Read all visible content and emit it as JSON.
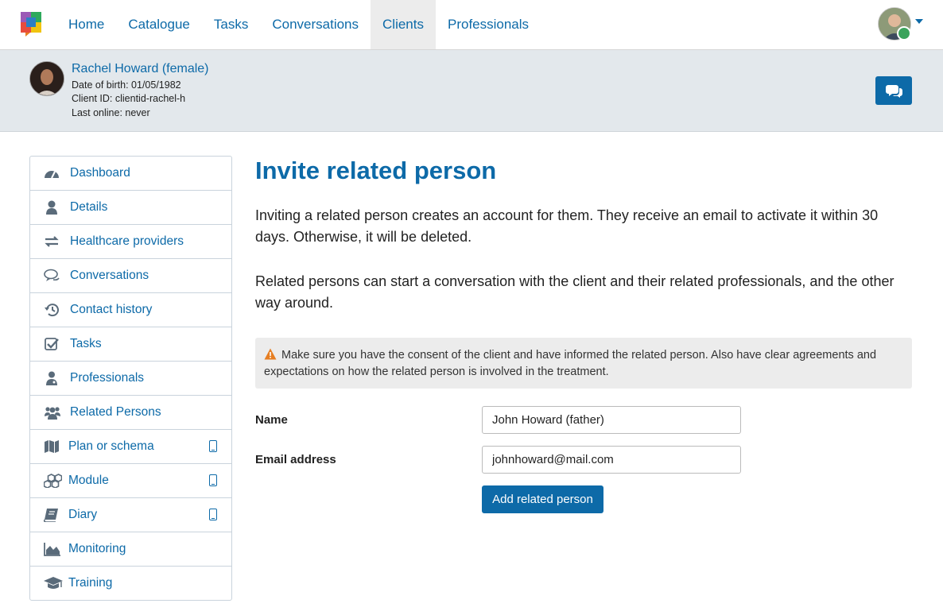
{
  "nav": {
    "items": [
      "Home",
      "Catalogue",
      "Tasks",
      "Conversations",
      "Clients",
      "Professionals"
    ],
    "active": "Clients"
  },
  "client": {
    "name": "Rachel Howard (female)",
    "dob": "Date of birth: 01/05/1982",
    "client_id": "Client ID: clientid-rachel-h",
    "last_online": "Last online: never"
  },
  "sidebar": {
    "items": [
      {
        "label": "Dashboard",
        "icon": "dashboard-icon"
      },
      {
        "label": "Details",
        "icon": "user-icon"
      },
      {
        "label": "Healthcare providers",
        "icon": "exchange-arrows-icon"
      },
      {
        "label": "Conversations",
        "icon": "comments-icon"
      },
      {
        "label": "Contact history",
        "icon": "history-icon"
      },
      {
        "label": "Tasks",
        "icon": "check-square-icon"
      },
      {
        "label": "Professionals",
        "icon": "user-doctor-icon"
      },
      {
        "label": "Related Persons",
        "icon": "users-icon"
      },
      {
        "label": "Plan or schema",
        "icon": "map-icon",
        "mobile": true
      },
      {
        "label": "Module",
        "icon": "cubes-icon",
        "mobile": true
      },
      {
        "label": "Diary",
        "icon": "book-icon",
        "mobile": true
      },
      {
        "label": "Monitoring",
        "icon": "area-chart-icon"
      },
      {
        "label": "Training",
        "icon": "graduation-cap-icon"
      }
    ]
  },
  "main": {
    "title": "Invite related person",
    "para1": "Inviting a related person creates an account for them. They receive an email to activate it within 30 days. Otherwise, it will be deleted.",
    "para2": "Related persons can start a conversation with the client and their related professionals, and the other way around.",
    "warning": "Make sure you have the consent of the client and have informed the related person. Also have clear agreements and expectations on how the related person is involved in the treatment.",
    "form": {
      "name_label": "Name",
      "name_value": "John Howard (father)",
      "email_label": "Email address",
      "email_value": "johnhoward@mail.com",
      "submit_label": "Add related person"
    }
  },
  "colors": {
    "primary": "#0d6aa8",
    "warning": "#e67e22",
    "client_bar": "#e3e8ec"
  }
}
